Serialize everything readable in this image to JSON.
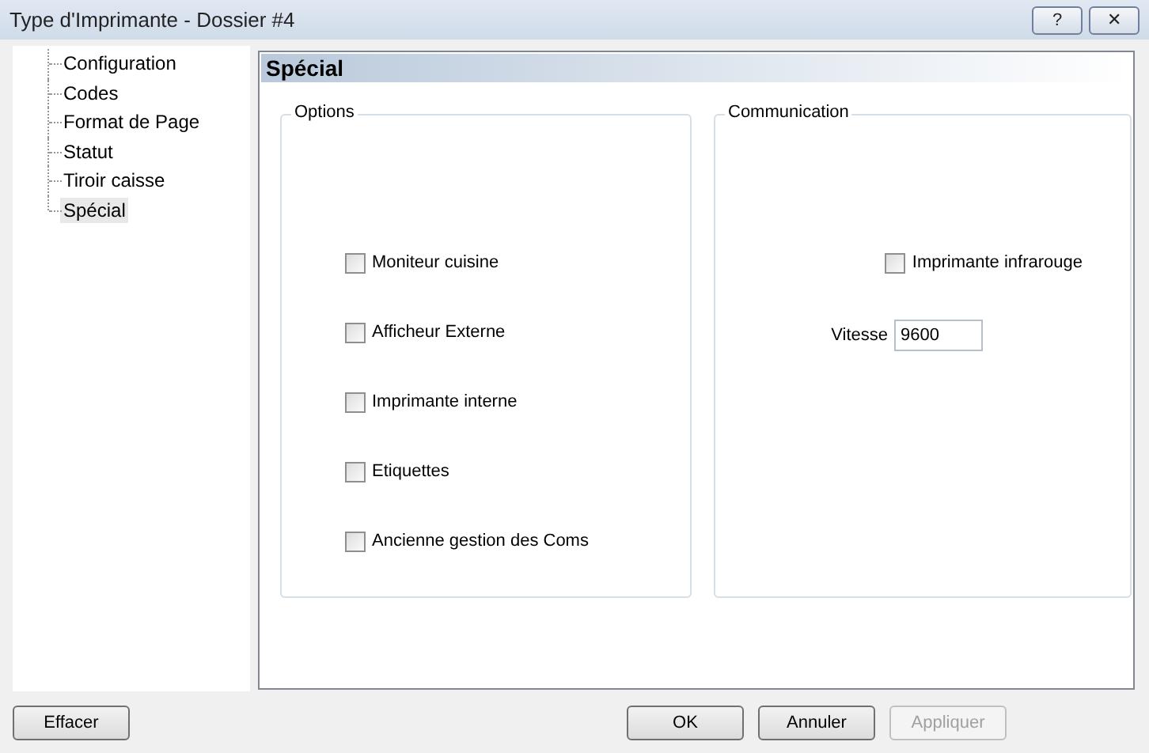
{
  "window": {
    "title": "Type d'Imprimante - Dossier #4",
    "controls": [
      "?",
      "✕"
    ]
  },
  "tree": {
    "items": [
      {
        "label": "Configuration",
        "selected": false
      },
      {
        "label": "Codes",
        "selected": false
      },
      {
        "label": "Format de Page",
        "selected": false
      },
      {
        "label": "Statut",
        "selected": false
      },
      {
        "label": "Tiroir caisse",
        "selected": false
      },
      {
        "label": "Spécial",
        "selected": true
      }
    ]
  },
  "panel": {
    "title": "Spécial",
    "groups": [
      {
        "title": "Options",
        "items": [
          {
            "kind": "checkbox",
            "label": "Moniteur cuisine",
            "checked": false
          },
          {
            "kind": "checkbox",
            "label": "Afficheur Externe",
            "checked": false
          },
          {
            "kind": "checkbox",
            "label": "Imprimante interne",
            "checked": false
          },
          {
            "kind": "checkbox",
            "label": "Etiquettes",
            "checked": false
          },
          {
            "kind": "checkbox",
            "label": "Ancienne gestion des Coms",
            "checked": false
          }
        ]
      },
      {
        "title": "Communication",
        "items": [
          {
            "kind": "checkbox",
            "label": "Imprimante infrarouge",
            "checked": false
          },
          {
            "kind": "field",
            "label": "Vitesse",
            "value": "9600"
          }
        ]
      }
    ]
  },
  "buttons": [
    {
      "label": "Effacer",
      "disabled": false
    },
    {
      "label": "OK",
      "disabled": false
    },
    {
      "label": "Annuler",
      "disabled": false
    },
    {
      "label": "Appliquer",
      "disabled": true
    }
  ]
}
